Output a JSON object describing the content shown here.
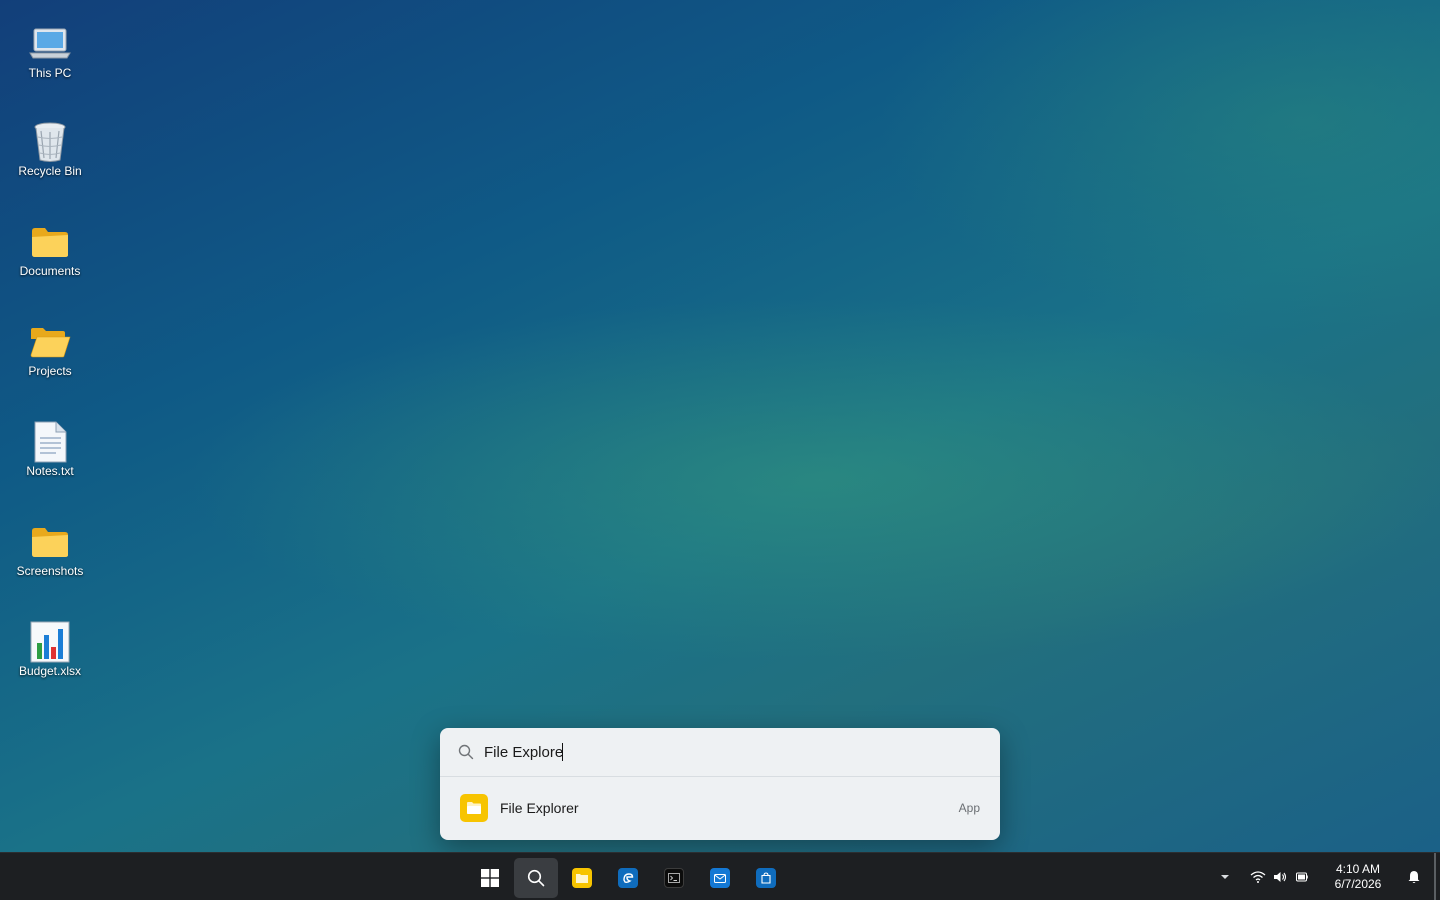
{
  "desktop": {
    "icons": [
      {
        "label": "This PC",
        "icon": "laptop-icon"
      },
      {
        "label": "Recycle Bin",
        "icon": "recycle-bin-icon"
      },
      {
        "label": "Documents",
        "icon": "folder-icon"
      },
      {
        "label": "Projects",
        "icon": "open-folder-icon"
      },
      {
        "label": "Notes.txt",
        "icon": "text-file-icon"
      },
      {
        "label": "Screenshots",
        "icon": "folder-icon"
      },
      {
        "label": "Budget.xlsx",
        "icon": "spreadsheet-chart-icon"
      }
    ]
  },
  "search": {
    "query": "File Explore",
    "results": [
      {
        "name": "File Explorer",
        "type": "App",
        "icon": "file-explorer-icon"
      }
    ]
  },
  "taskbar": {
    "buttons": [
      "start-button",
      "search-button",
      "file-explorer",
      "edge",
      "terminal",
      "mail",
      "store"
    ],
    "clock": {
      "time": "4:10 AM",
      "date": "6/7/2026"
    },
    "tray": [
      "chevron-up-icon",
      "wifi-icon",
      "volume-icon",
      "battery-icon",
      "notification-bell-icon"
    ]
  },
  "colors": {
    "accent_blue": "#0f6cbd",
    "folder_yellow": "#f7c400",
    "taskbar_bg": "#1d1f22"
  }
}
